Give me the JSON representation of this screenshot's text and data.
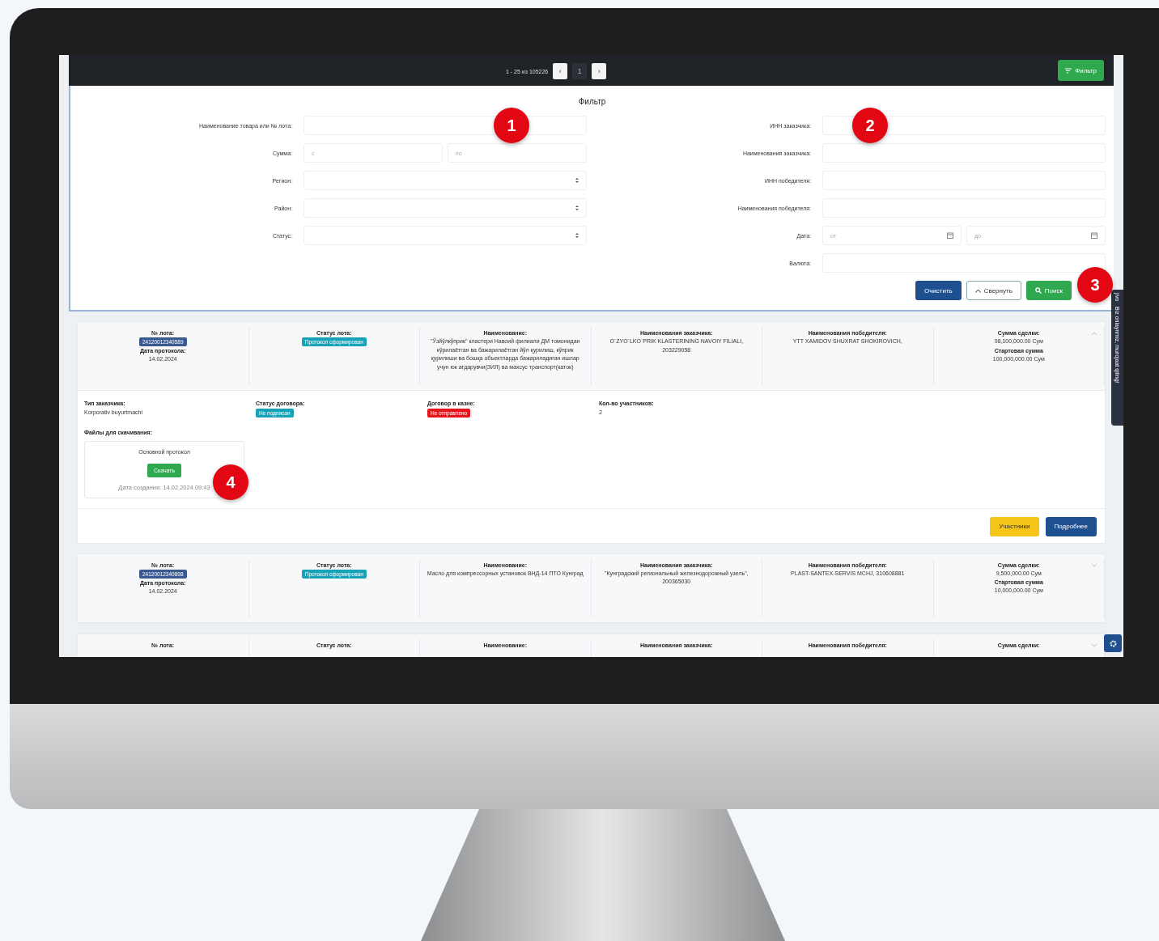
{
  "toolbar": {
    "range": "1 - 25 из 105226",
    "prev": "‹",
    "page": "1",
    "next": "›",
    "filter_button": "Фильтр"
  },
  "filter": {
    "title": "Фильтр",
    "left_fields": [
      {
        "label": "Наименование товара или № лота:",
        "kind": "text"
      },
      {
        "label": "Сумма:",
        "kind": "range",
        "from": "с",
        "to": "по"
      },
      {
        "label": "Регион:",
        "kind": "select"
      },
      {
        "label": "Район:",
        "kind": "select"
      },
      {
        "label": "Статус:",
        "kind": "select"
      }
    ],
    "right_fields": [
      {
        "label": "ИНН заказчика:",
        "kind": "text"
      },
      {
        "label": "Наименования заказчика:",
        "kind": "text"
      },
      {
        "label": "ИНН победителя:",
        "kind": "text"
      },
      {
        "label": "Наименования победителя:",
        "kind": "text"
      },
      {
        "label": "Дата:",
        "kind": "date",
        "from": "от",
        "to": "до"
      },
      {
        "label": "Валюта:",
        "kind": "text"
      }
    ],
    "buttons": [
      {
        "label": "Очистить",
        "kind": "primary"
      },
      {
        "label": "Свернуть",
        "kind": "outline"
      },
      {
        "label": "Поиск",
        "kind": "success"
      }
    ]
  },
  "lots": [
    {
      "expanded": true,
      "lot_label": "№ лота:",
      "lot_number": "24120012340589",
      "date_label": "Дата протокола:",
      "date": "14.02.2024",
      "status_label": "Статус лота:",
      "status": "Протокол сформирован",
      "name_label": "Наименование:",
      "name": "\"Ўзйўлкўприк\" кластери Навоий филиали ДМ томонидан кўрилаётган ва бажарилаётган йўл қурилиш, кўприк қурилиши ва бошқа объектларда бажариладиган ишлар учун юк ағдарувчи(ЗИЛ) ва махсус транспорт(каток)",
      "customer_label": "Наименования заказчика:",
      "customer": "O`ZYO`LKO`PRIK KLASTERINING NAVOIY FILIALI, 203229058",
      "winner_label": "Наименования победителя:",
      "winner": "YTT XAMIDOV SHUXRAT SHOKIROVICH,",
      "deal_label": "Сумма сделки:",
      "deal": "98,100,000.00 Сум",
      "start_label": "Стартовая сумма",
      "start": "100,000,000.00 Сум",
      "details": {
        "customer_type_label": "Тип заказчика:",
        "customer_type": "Korporativ buyurtmachi",
        "contract_status_label": "Статус договора:",
        "contract_status": "Не подписан",
        "treasury_label": "Договор в казне:",
        "treasury": "Не отправлено",
        "participants_label": "Кол-во участников:",
        "participants": "2",
        "files_label": "Файлы для скачивания:",
        "file": {
          "title": "Основной протокол",
          "button": "Скачать",
          "created": "Дата создания: 14.02.2024 09:43"
        }
      },
      "actions": [
        {
          "label": "Участники",
          "kind": "warning"
        },
        {
          "label": "Подробнее",
          "kind": "primary"
        }
      ]
    },
    {
      "expanded": false,
      "lot_label": "№ лота:",
      "lot_number": "24120012340898",
      "date_label": "Дата протокола:",
      "date": "14.02.2024",
      "status_label": "Статус лота:",
      "status": "Протокол сформирован",
      "name_label": "Наименование:",
      "name": "Масло для компрессорных установок ВНД-14 ПТО Кунград",
      "customer_label": "Наименования заказчика:",
      "customer": "\"Кунградский региональный железнодорожный узель\", 200365030",
      "winner_label": "Наименования победителя:",
      "winner": "PLAST-SANTEX-SERVIS MCHJ, 310608881",
      "deal_label": "Сумма сделки:",
      "deal": "9,500,000.00 Сум",
      "start_label": "Стартовая сумма",
      "start": "10,000,000.00 Сум"
    },
    {
      "expanded": false,
      "lot_label": "№ лота:",
      "status_label": "Статус лота:",
      "name_label": "Наименование:",
      "customer_label": "Наименования заказчика:",
      "winner_label": "Наименования победителя:",
      "deal_label": "Сумма сделки:"
    }
  ],
  "chat_tab": {
    "text": "Biz onlaynmiz, murojaat qiling!",
    "brand": "jivo"
  },
  "callouts": [
    "1",
    "2",
    "3",
    "4"
  ]
}
